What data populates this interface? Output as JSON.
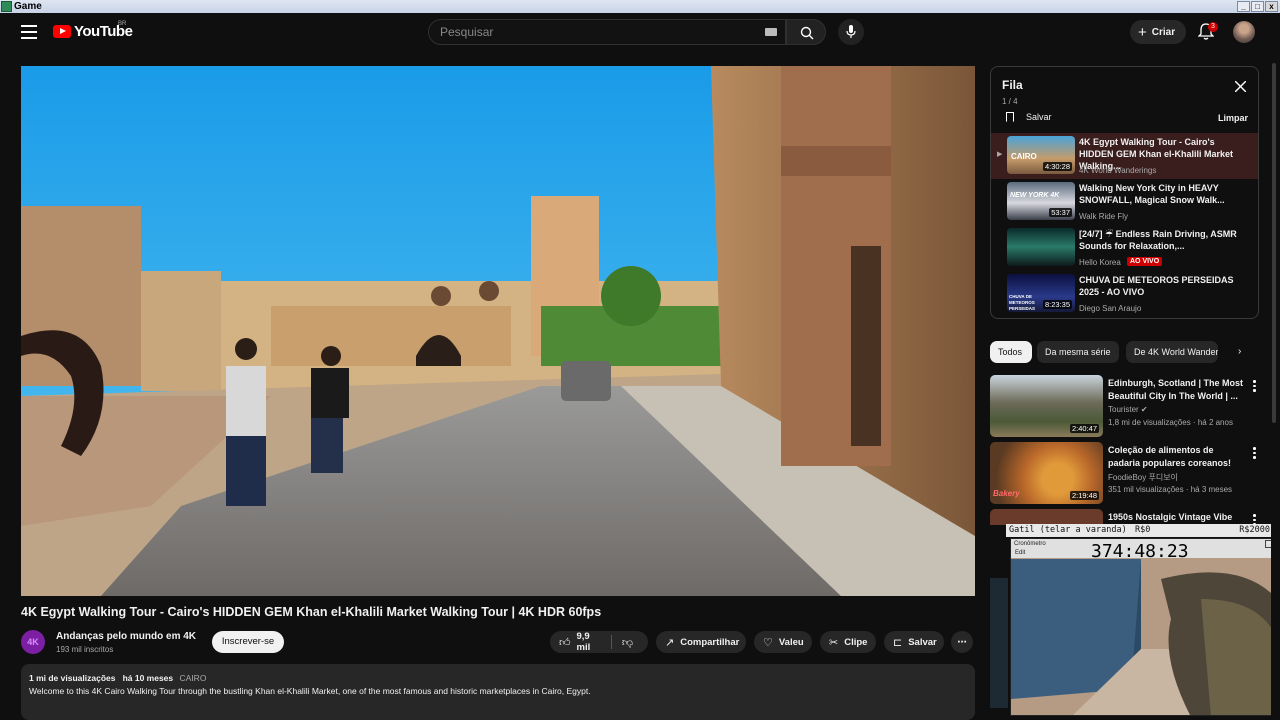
{
  "window": {
    "title": "Game"
  },
  "header": {
    "logo_text": "YouTube",
    "region": "BR",
    "search_placeholder": "Pesquisar",
    "create_label": "Criar",
    "notifications_count": "3"
  },
  "video": {
    "title": "4K Egypt Walking Tour - Cairo's HIDDEN GEM Khan el-Khalili Market Walking Tour | 4K HDR 60fps",
    "channel_initials": "4K",
    "channel_name": "Andanças pelo mundo em 4K",
    "subscribers": "193 mil inscritos",
    "subscribe_label": "Inscrever-se",
    "likes": "9,9 mil",
    "share_label": "Compartilhar",
    "thanks_label": "Valeu",
    "clip_label": "Clipe",
    "save_label": "Salvar",
    "views": "1 mi de visualizações",
    "age": "há 10 meses",
    "location_tag": "CAIRO",
    "description": "Welcome to this 4K Cairo Walking Tour through the bustling Khan el-Khalili Market, one of the most famous and historic marketplaces in Cairo, Egypt."
  },
  "queue": {
    "title": "Fila",
    "count": "1 / 4",
    "save_label": "Salvar",
    "clear_label": "Limpar",
    "items": [
      {
        "title": "4K Egypt Walking Tour - Cairo's HIDDEN GEM Khan el-Khalili Market Walking...",
        "channel": "4K World Wanderings",
        "duration": "4:30:28",
        "thumb_text": "CAIRO"
      },
      {
        "title": "Walking New York City in HEAVY SNOWFALL, Magical Snow Walk...",
        "channel": "Walk Ride Fly",
        "duration": "53:37",
        "thumb_text": "NEW YORK 4K"
      },
      {
        "title": "[24/7] ☔ Endless Rain Driving, ASMR Sounds for Relaxation,...",
        "channel": "Hello Korea",
        "live_label": "AO VIVO"
      },
      {
        "title": "CHUVA DE METEOROS PERSEIDAS 2025 - AO VIVO",
        "channel": "Diego San Araujo",
        "duration": "8:23:35",
        "thumb_text": "CHUVA DE METEOROS PERSEIDAS"
      }
    ]
  },
  "chips": [
    "Todos",
    "Da mesma série",
    "De 4K World Wanderings"
  ],
  "recommendations": [
    {
      "title": "Edinburgh, Scotland | The Most Beautiful City In The World | ...",
      "channel": "Tourister",
      "meta": "1,8 mi de visualizações · há 2 anos",
      "duration": "2:40:47"
    },
    {
      "title": "Coleção de alimentos de padaria populares coreanos!",
      "channel": "FoodieBoy 푸디보이",
      "meta": "351 mil visualizações · há 3 meses",
      "duration": "2:19:48",
      "thumb_text": "Bakery"
    },
    {
      "title": "1950s Nostalgic Vintage Vibe"
    }
  ],
  "overlay": {
    "left": "Gatil (telar a varanda)",
    "mid": "R$0",
    "right": "R$2000",
    "cam_title": "Cronômetro",
    "cam_sub": "Edit",
    "timer": "374:48:23"
  },
  "colors": {
    "brand": "#ff0000",
    "live": "#cc0000",
    "bg": "#0f0f0f"
  }
}
